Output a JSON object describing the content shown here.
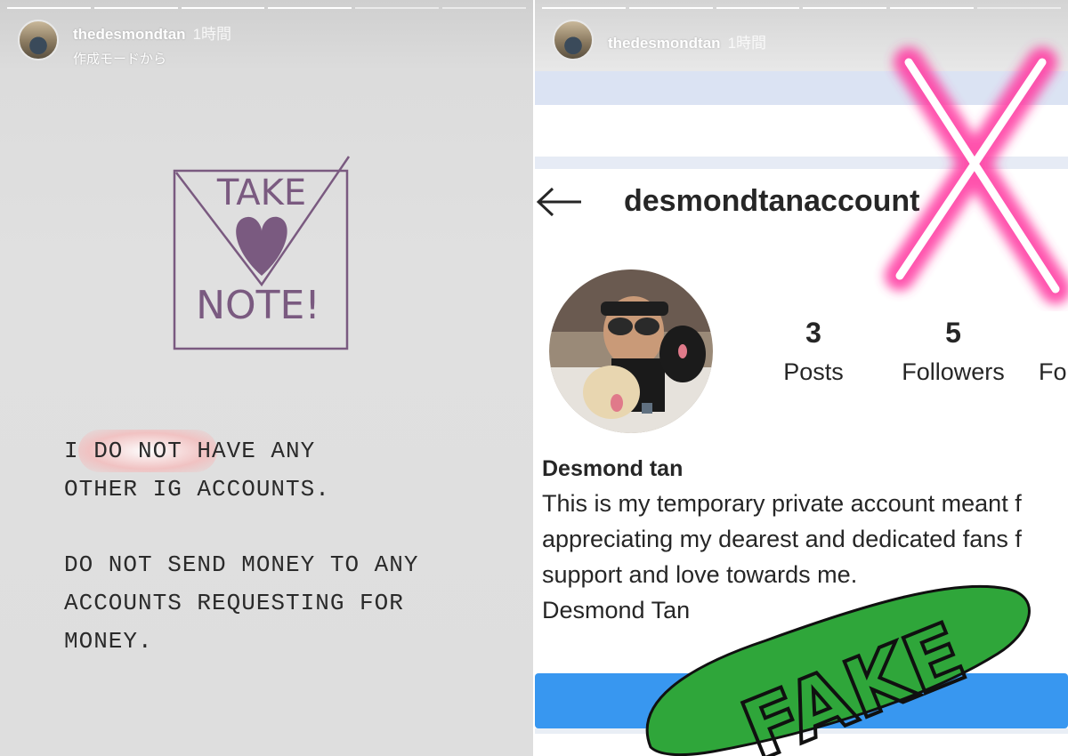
{
  "left_story": {
    "username": "thedesmondtan",
    "time": "1時間",
    "subtitle": "作成モードから",
    "progress_segments": 6,
    "progress_complete": 4,
    "sticker": {
      "line1": "TAKE",
      "line2": "NOTE!"
    },
    "notice_lines": [
      "I DO NOT HAVE ANY",
      "OTHER IG ACCOUNTS.",
      "DO NOT SEND MONEY TO ANY",
      "ACCOUNTS REQUESTING FOR",
      "MONEY."
    ],
    "highlighted_phrase": "DO NOT"
  },
  "right_story": {
    "username": "thedesmondtan",
    "time": "1時間",
    "progress_segments": 6,
    "progress_complete": 5,
    "profile": {
      "handle": "desmondtanaccount",
      "posts_count": "3",
      "posts_label": "Posts",
      "followers_count": "5",
      "followers_label": "Followers",
      "following_label": "Fo",
      "name": "Desmond tan",
      "bio_lines": [
        "This is my temporary private account meant f",
        "appreciating my dearest and dedicated fans f",
        "support and love towards me.",
        "Desmond Tan"
      ]
    },
    "stamp_text": "FAKE",
    "colors": {
      "x_mark": "#ff3fa4",
      "stamp_fill": "#2fa63a",
      "follow_button": "#3897f0"
    }
  }
}
